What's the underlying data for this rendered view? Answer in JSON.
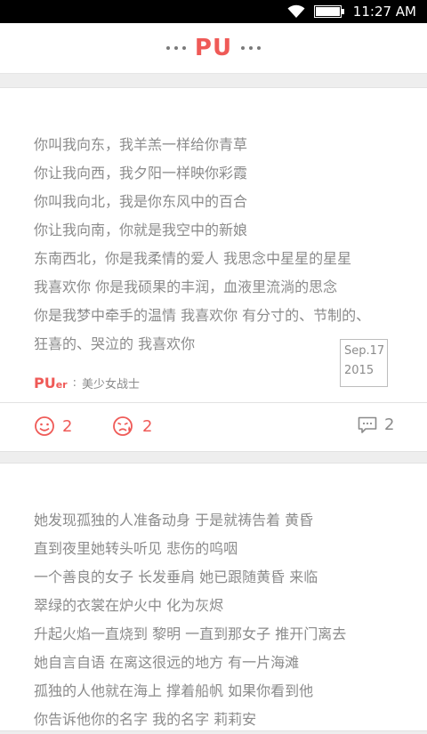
{
  "status_bar": {
    "time": "11:27 AM"
  },
  "header": {
    "logo": "PU"
  },
  "cards": [
    {
      "lines": [
        "你叫我向东，我羊羔一样给你青草",
        "你让我向西，我夕阳一样映你彩霞",
        "你叫我向北，我是你东风中的百合",
        "你让我向南，你就是我空中的新娘",
        "东南西北，你是我柔情的爱人 我思念中星星的星星",
        "我喜欢你 你是我硕果的丰润，血液里流淌的思念",
        "你是我梦中牵手的温情 我喜欢你 有分寸的、节制的、",
        "狂喜的、哭泣的 我喜欢你"
      ],
      "date": {
        "month_day": "Sep.17",
        "year": "2015"
      },
      "author": {
        "tag": "PU",
        "tag_suffix": "er",
        "colon": ":",
        "name": "美少女战士"
      },
      "actions": {
        "smile_count": "2",
        "cry_count": "2",
        "comment_count": "2"
      }
    },
    {
      "lines": [
        "她发现孤独的人准备动身 于是就祷告着 黄昏",
        "直到夜里她转头听见 悲伤的呜咽",
        "一个善良的女子 长发垂肩 她已跟随黄昏 来临",
        "翠绿的衣裳在炉火中 化为灰烬",
        "升起火焰一直烧到 黎明 一直到那女子 推开门离去",
        "她自言自语 在离这很远的地方 有一片海滩",
        "孤独的人他就在海上 撑着船帆 如果你看到他",
        "你告诉他你的名字 我的名字 莉莉安"
      ]
    }
  ],
  "colors": {
    "accent": "#ef5a57",
    "text": "#8b8b8b",
    "background": "#eeeeee"
  }
}
